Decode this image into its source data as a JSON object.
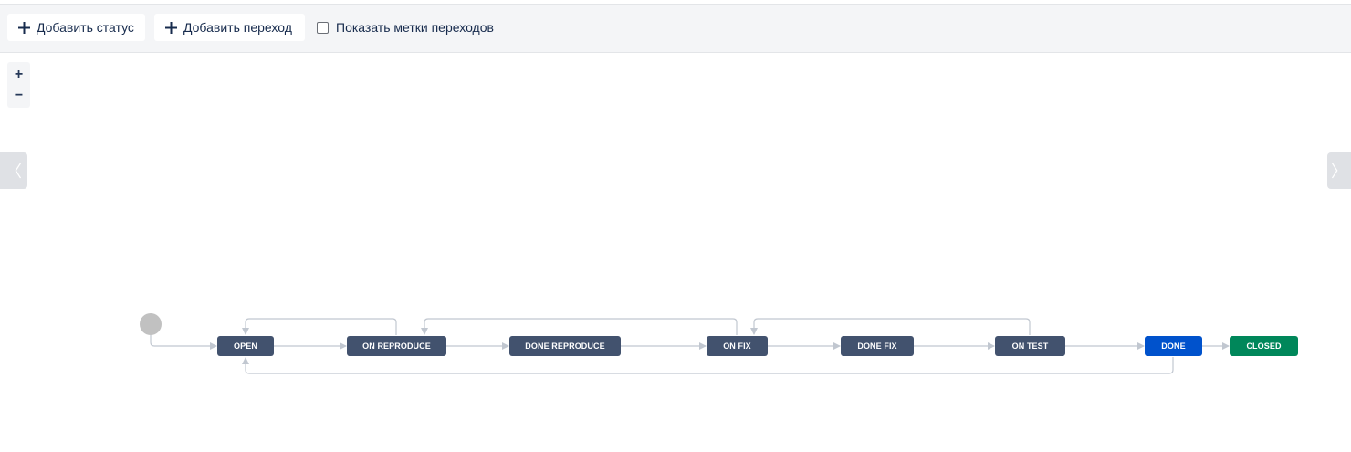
{
  "toolbar": {
    "add_status_label": "Добавить статус",
    "add_transition_label": "Добавить переход",
    "show_labels_label": "Показать метки переходов",
    "show_labels_checked": false
  },
  "zoom": {
    "in_label": "+",
    "out_label": "−"
  },
  "nav": {
    "prev_label": "〈",
    "next_label": "〉"
  },
  "workflow": {
    "statuses": [
      {
        "id": "open",
        "label": "OPEN",
        "category": "todo"
      },
      {
        "id": "on-reproduce",
        "label": "ON REPRODUCE",
        "category": "todo"
      },
      {
        "id": "done-reproduce",
        "label": "DONE REPRODUCE",
        "category": "todo"
      },
      {
        "id": "on-fix",
        "label": "ON FIX",
        "category": "todo"
      },
      {
        "id": "done-fix",
        "label": "DONE FIX",
        "category": "todo"
      },
      {
        "id": "on-test",
        "label": "ON TEST",
        "category": "todo"
      },
      {
        "id": "done",
        "label": "DONE",
        "category": "in-progress"
      },
      {
        "id": "closed",
        "label": "CLOSED",
        "category": "done"
      }
    ],
    "transitions": [
      {
        "from": "start",
        "to": "open"
      },
      {
        "from": "open",
        "to": "on-reproduce"
      },
      {
        "from": "on-reproduce",
        "to": "done-reproduce"
      },
      {
        "from": "done-reproduce",
        "to": "on-fix"
      },
      {
        "from": "on-fix",
        "to": "done-fix"
      },
      {
        "from": "done-fix",
        "to": "on-test"
      },
      {
        "from": "on-test",
        "to": "done"
      },
      {
        "from": "done",
        "to": "closed"
      },
      {
        "from": "on-reproduce",
        "to": "open"
      },
      {
        "from": "on-fix",
        "to": "on-reproduce"
      },
      {
        "from": "on-test",
        "to": "on-fix"
      },
      {
        "from": "done",
        "to": "open"
      }
    ]
  },
  "colors": {
    "status_todo": "#42526e",
    "status_in_progress": "#0052cc",
    "status_done": "#00875a",
    "start_node": "#c1c1c1",
    "connector": "#c1c7d0",
    "toolbar_bg": "#f4f5f7"
  },
  "icons": {
    "add_status": "plus-icon",
    "add_transition": "plus-icon",
    "start": "start-circle-icon"
  }
}
